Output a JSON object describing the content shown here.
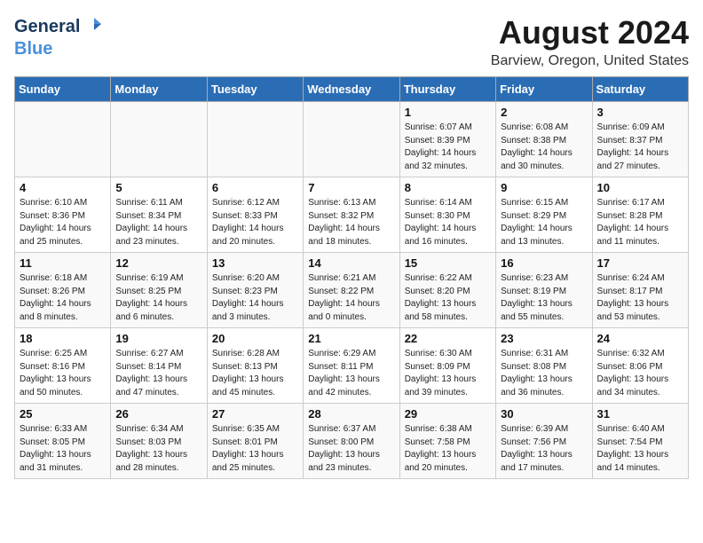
{
  "header": {
    "logo_general": "General",
    "logo_blue": "Blue",
    "title": "August 2024",
    "location": "Barview, Oregon, United States"
  },
  "days_of_week": [
    "Sunday",
    "Monday",
    "Tuesday",
    "Wednesday",
    "Thursday",
    "Friday",
    "Saturday"
  ],
  "weeks": [
    [
      {
        "day": "",
        "info": ""
      },
      {
        "day": "",
        "info": ""
      },
      {
        "day": "",
        "info": ""
      },
      {
        "day": "",
        "info": ""
      },
      {
        "day": "1",
        "info": "Sunrise: 6:07 AM\nSunset: 8:39 PM\nDaylight: 14 hours\nand 32 minutes."
      },
      {
        "day": "2",
        "info": "Sunrise: 6:08 AM\nSunset: 8:38 PM\nDaylight: 14 hours\nand 30 minutes."
      },
      {
        "day": "3",
        "info": "Sunrise: 6:09 AM\nSunset: 8:37 PM\nDaylight: 14 hours\nand 27 minutes."
      }
    ],
    [
      {
        "day": "4",
        "info": "Sunrise: 6:10 AM\nSunset: 8:36 PM\nDaylight: 14 hours\nand 25 minutes."
      },
      {
        "day": "5",
        "info": "Sunrise: 6:11 AM\nSunset: 8:34 PM\nDaylight: 14 hours\nand 23 minutes."
      },
      {
        "day": "6",
        "info": "Sunrise: 6:12 AM\nSunset: 8:33 PM\nDaylight: 14 hours\nand 20 minutes."
      },
      {
        "day": "7",
        "info": "Sunrise: 6:13 AM\nSunset: 8:32 PM\nDaylight: 14 hours\nand 18 minutes."
      },
      {
        "day": "8",
        "info": "Sunrise: 6:14 AM\nSunset: 8:30 PM\nDaylight: 14 hours\nand 16 minutes."
      },
      {
        "day": "9",
        "info": "Sunrise: 6:15 AM\nSunset: 8:29 PM\nDaylight: 14 hours\nand 13 minutes."
      },
      {
        "day": "10",
        "info": "Sunrise: 6:17 AM\nSunset: 8:28 PM\nDaylight: 14 hours\nand 11 minutes."
      }
    ],
    [
      {
        "day": "11",
        "info": "Sunrise: 6:18 AM\nSunset: 8:26 PM\nDaylight: 14 hours\nand 8 minutes."
      },
      {
        "day": "12",
        "info": "Sunrise: 6:19 AM\nSunset: 8:25 PM\nDaylight: 14 hours\nand 6 minutes."
      },
      {
        "day": "13",
        "info": "Sunrise: 6:20 AM\nSunset: 8:23 PM\nDaylight: 14 hours\nand 3 minutes."
      },
      {
        "day": "14",
        "info": "Sunrise: 6:21 AM\nSunset: 8:22 PM\nDaylight: 14 hours\nand 0 minutes."
      },
      {
        "day": "15",
        "info": "Sunrise: 6:22 AM\nSunset: 8:20 PM\nDaylight: 13 hours\nand 58 minutes."
      },
      {
        "day": "16",
        "info": "Sunrise: 6:23 AM\nSunset: 8:19 PM\nDaylight: 13 hours\nand 55 minutes."
      },
      {
        "day": "17",
        "info": "Sunrise: 6:24 AM\nSunset: 8:17 PM\nDaylight: 13 hours\nand 53 minutes."
      }
    ],
    [
      {
        "day": "18",
        "info": "Sunrise: 6:25 AM\nSunset: 8:16 PM\nDaylight: 13 hours\nand 50 minutes."
      },
      {
        "day": "19",
        "info": "Sunrise: 6:27 AM\nSunset: 8:14 PM\nDaylight: 13 hours\nand 47 minutes."
      },
      {
        "day": "20",
        "info": "Sunrise: 6:28 AM\nSunset: 8:13 PM\nDaylight: 13 hours\nand 45 minutes."
      },
      {
        "day": "21",
        "info": "Sunrise: 6:29 AM\nSunset: 8:11 PM\nDaylight: 13 hours\nand 42 minutes."
      },
      {
        "day": "22",
        "info": "Sunrise: 6:30 AM\nSunset: 8:09 PM\nDaylight: 13 hours\nand 39 minutes."
      },
      {
        "day": "23",
        "info": "Sunrise: 6:31 AM\nSunset: 8:08 PM\nDaylight: 13 hours\nand 36 minutes."
      },
      {
        "day": "24",
        "info": "Sunrise: 6:32 AM\nSunset: 8:06 PM\nDaylight: 13 hours\nand 34 minutes."
      }
    ],
    [
      {
        "day": "25",
        "info": "Sunrise: 6:33 AM\nSunset: 8:05 PM\nDaylight: 13 hours\nand 31 minutes."
      },
      {
        "day": "26",
        "info": "Sunrise: 6:34 AM\nSunset: 8:03 PM\nDaylight: 13 hours\nand 28 minutes."
      },
      {
        "day": "27",
        "info": "Sunrise: 6:35 AM\nSunset: 8:01 PM\nDaylight: 13 hours\nand 25 minutes."
      },
      {
        "day": "28",
        "info": "Sunrise: 6:37 AM\nSunset: 8:00 PM\nDaylight: 13 hours\nand 23 minutes."
      },
      {
        "day": "29",
        "info": "Sunrise: 6:38 AM\nSunset: 7:58 PM\nDaylight: 13 hours\nand 20 minutes."
      },
      {
        "day": "30",
        "info": "Sunrise: 6:39 AM\nSunset: 7:56 PM\nDaylight: 13 hours\nand 17 minutes."
      },
      {
        "day": "31",
        "info": "Sunrise: 6:40 AM\nSunset: 7:54 PM\nDaylight: 13 hours\nand 14 minutes."
      }
    ]
  ]
}
